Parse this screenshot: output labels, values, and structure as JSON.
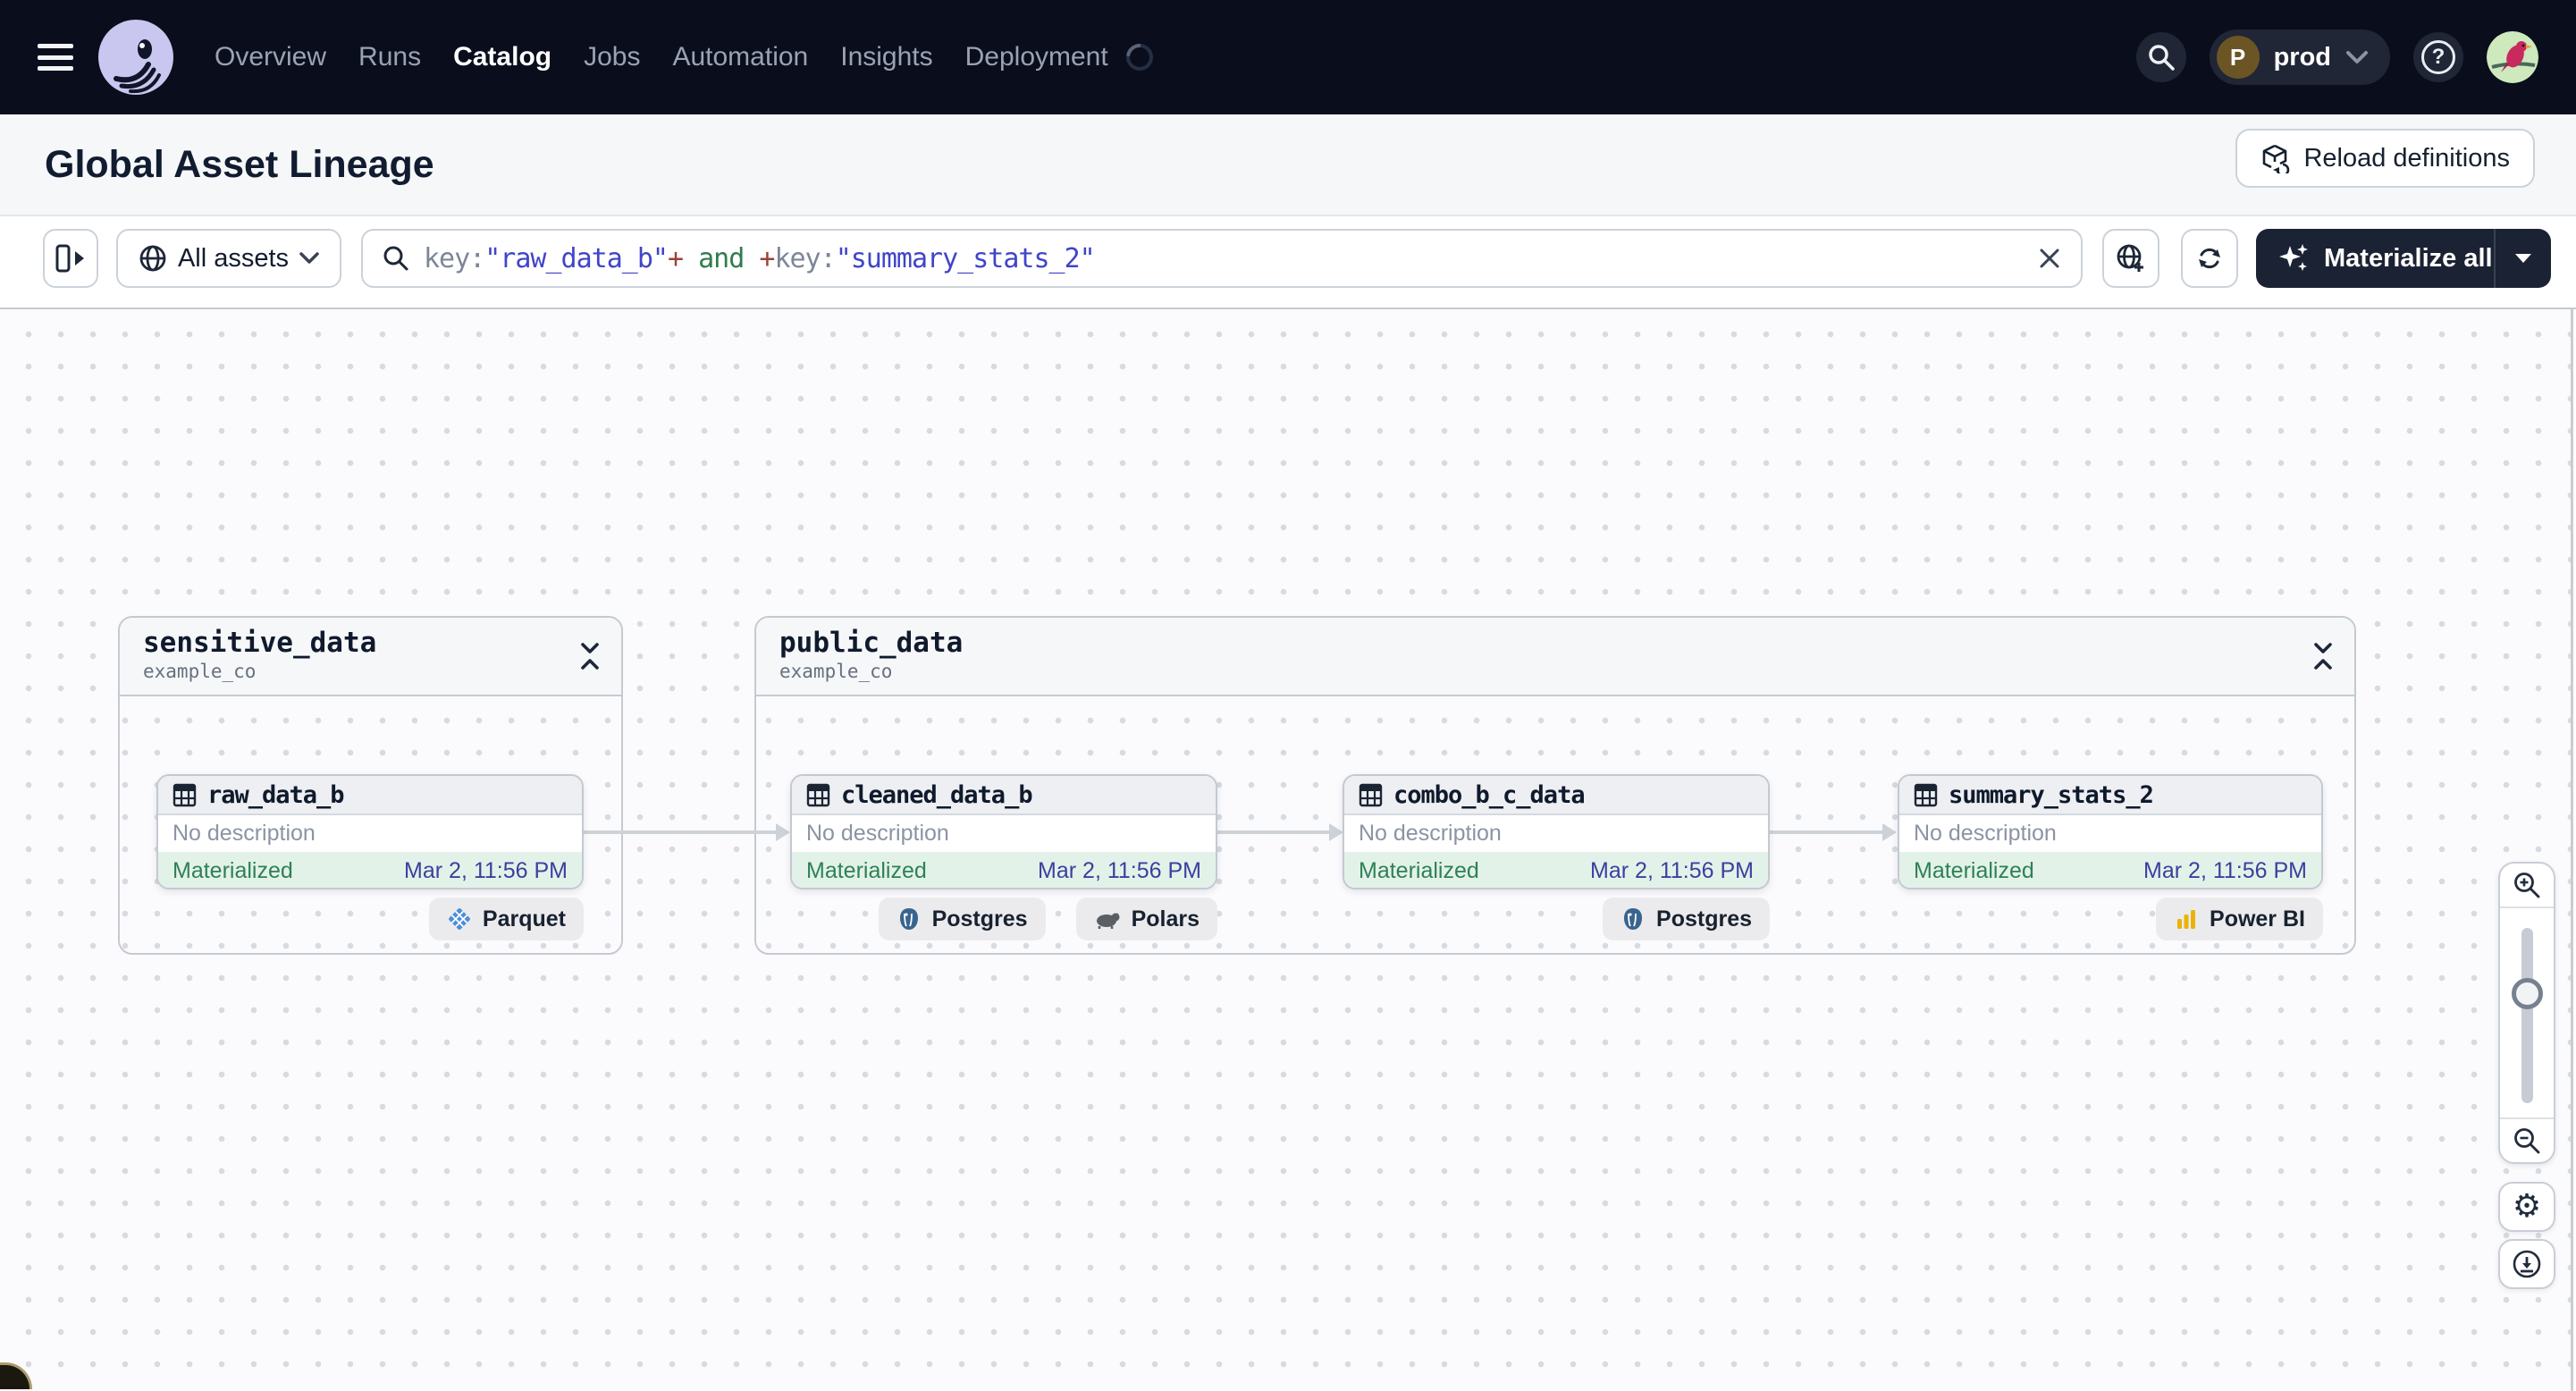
{
  "nav": {
    "items": [
      {
        "label": "Overview"
      },
      {
        "label": "Runs"
      },
      {
        "label": "Catalog"
      },
      {
        "label": "Jobs"
      },
      {
        "label": "Automation"
      },
      {
        "label": "Insights"
      },
      {
        "label": "Deployment"
      }
    ],
    "active": "Catalog"
  },
  "topbar": {
    "deployment_initial": "P",
    "deployment_name": "prod"
  },
  "header": {
    "title": "Global Asset Lineage",
    "reload_button": "Reload definitions"
  },
  "toolbar": {
    "scope_label": "All assets",
    "query": {
      "segments": [
        {
          "text": "key:",
          "type": "key"
        },
        {
          "text": "\"raw_data_b\"",
          "type": "string"
        },
        {
          "text": "+",
          "type": "plus"
        },
        {
          "text": " and ",
          "type": "and"
        },
        {
          "text": "+",
          "type": "plus"
        },
        {
          "text": "key:",
          "type": "key"
        },
        {
          "text": "\"summary_stats_2\"",
          "type": "string"
        }
      ]
    },
    "materialize_button": "Materialize all"
  },
  "graph": {
    "groups": [
      {
        "name": "sensitive_data",
        "repo": "example_co",
        "nodes": [
          {
            "name": "raw_data_b",
            "description": "No description",
            "status": "Materialized",
            "timestamp": "Mar 2, 11:56 PM",
            "badges": [
              {
                "label": "Parquet"
              }
            ]
          }
        ]
      },
      {
        "name": "public_data",
        "repo": "example_co",
        "nodes": [
          {
            "name": "cleaned_data_b",
            "description": "No description",
            "status": "Materialized",
            "timestamp": "Mar 2, 11:56 PM",
            "badges": [
              {
                "label": "Postgres"
              },
              {
                "label": "Polars"
              }
            ]
          },
          {
            "name": "combo_b_c_data",
            "description": "No description",
            "status": "Materialized",
            "timestamp": "Mar 2, 11:56 PM",
            "badges": [
              {
                "label": "Postgres"
              }
            ]
          },
          {
            "name": "summary_stats_2",
            "description": "No description",
            "status": "Materialized",
            "timestamp": "Mar 2, 11:56 PM",
            "badges": [
              {
                "label": "Power BI"
              }
            ]
          }
        ]
      }
    ]
  },
  "colors": {
    "nav_background": "#0a0e1c",
    "dark_button": "#1b2233",
    "materialized_bg": "#e3f2e9",
    "materialized_text": "#2e8155",
    "timestamp_text": "#3b409e",
    "query_key": "#7d8697",
    "query_string": "#4045c8",
    "query_plus": "#9a4137",
    "query_and": "#2f7d4c",
    "deployment_avatar_bg": "#6b5524"
  }
}
